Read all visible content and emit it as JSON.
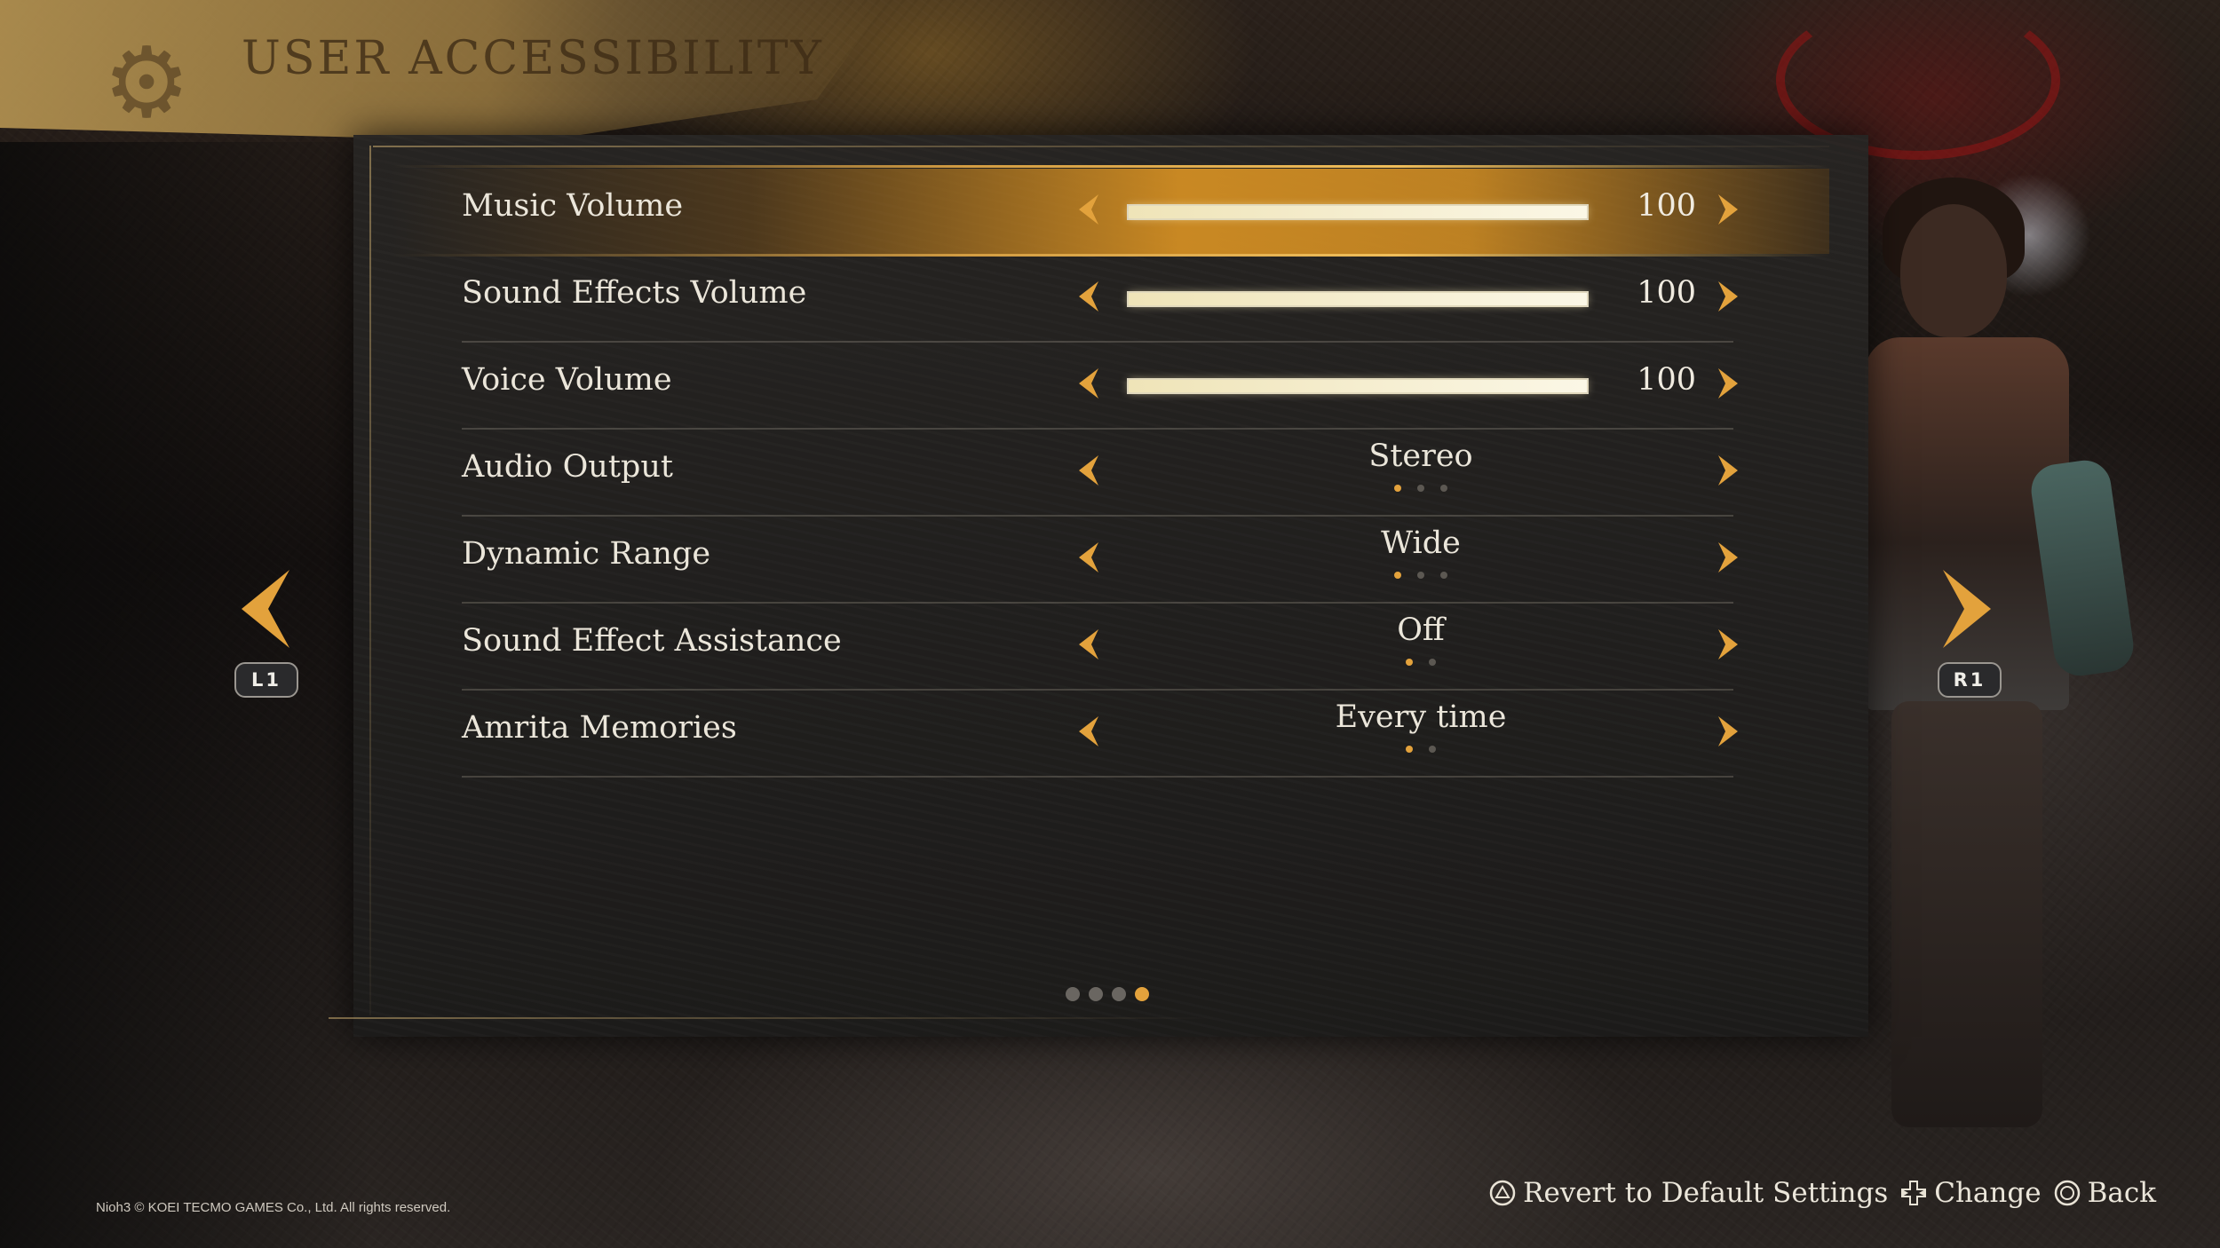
{
  "header": {
    "title": "USER ACCESSIBILITY",
    "icon": "gear-icon"
  },
  "settings": [
    {
      "label": "Music Volume",
      "type": "slider",
      "value": "100",
      "level": 1.0,
      "selected": true
    },
    {
      "label": "Sound Effects Volume",
      "type": "slider",
      "value": "100",
      "level": 1.0,
      "selected": false
    },
    {
      "label": "Voice Volume",
      "type": "slider",
      "value": "100",
      "level": 1.0,
      "selected": false
    },
    {
      "label": "Audio Output",
      "type": "option",
      "value": "Stereo",
      "option_count": 3,
      "option_index": 0,
      "selected": false
    },
    {
      "label": "Dynamic Range",
      "type": "option",
      "value": "Wide",
      "option_count": 3,
      "option_index": 0,
      "selected": false
    },
    {
      "label": "Sound Effect Assistance",
      "type": "option",
      "value": "Off",
      "option_count": 2,
      "option_index": 0,
      "selected": false
    },
    {
      "label": "Amrita Memories",
      "type": "option",
      "value": "Every time",
      "option_count": 2,
      "option_index": 0,
      "selected": false
    }
  ],
  "pagination": {
    "total": 4,
    "current": 4
  },
  "nav": {
    "left_button": "L1",
    "right_button": "R1"
  },
  "footer": {
    "copyright": "Nioh3 © KOEI TECMO GAMES Co., Ltd. All rights reserved.",
    "hints": [
      {
        "icon": "triangle-button-icon",
        "label": "Revert to Default Settings"
      },
      {
        "icon": "dpad-icon",
        "label": "Change"
      },
      {
        "icon": "circle-button-icon",
        "label": "Back"
      }
    ]
  },
  "colors": {
    "accent": "#e3a23c",
    "highlight": "#d7912a",
    "text": "#ebe6da",
    "panel": "#262422"
  }
}
